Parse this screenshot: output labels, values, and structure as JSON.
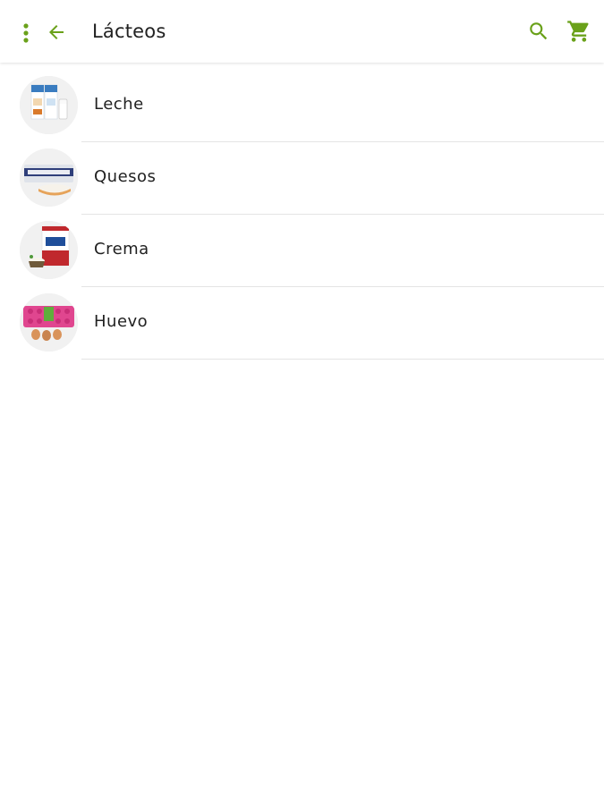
{
  "colors": {
    "accent": "#6aa11a",
    "title_text": "#212121",
    "divider": "#e4e4e4"
  },
  "app_bar": {
    "title": "Lácteos",
    "icons": {
      "menu": "more-vertical-icon",
      "back": "arrow-back-icon",
      "search": "search-icon",
      "cart": "shopping-cart-icon"
    }
  },
  "categories": [
    {
      "label": "Leche",
      "image": "milk-cartons-image"
    },
    {
      "label": "Quesos",
      "image": "cream-cheese-image"
    },
    {
      "label": "Crema",
      "image": "cream-container-image"
    },
    {
      "label": "Huevo",
      "image": "egg-carton-image"
    }
  ]
}
